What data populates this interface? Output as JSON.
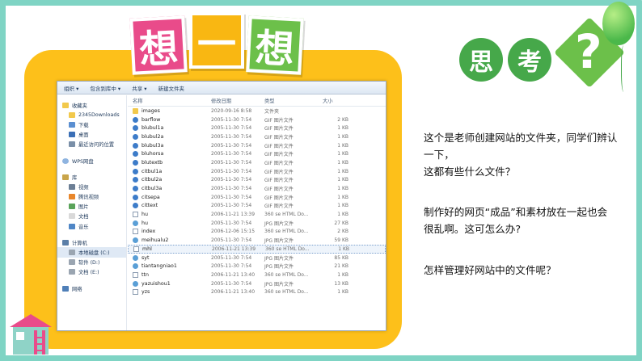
{
  "title_chars": [
    "想",
    "一",
    "想"
  ],
  "think": {
    "char1": "思",
    "char2": "考",
    "qmark": "?"
  },
  "toolbar": {
    "items": [
      "组织 ▾",
      "包含到库中 ▾",
      "共享 ▾",
      "新建文件夹"
    ]
  },
  "nav": {
    "favorites": "收藏夹",
    "fav_items": [
      "2345Downloads",
      "下载",
      "桌面",
      "最近访问的位置"
    ],
    "wps": "WPS网盘",
    "library": "库",
    "lib_items": [
      "视频",
      "腾讯视频",
      "图片",
      "文档",
      "音乐"
    ],
    "computer": "计算机",
    "comp_items": [
      "本地磁盘 (C:)",
      "软件 (D:)",
      "文档 (E:)"
    ],
    "network": "网络"
  },
  "columns": {
    "name": "名称",
    "date": "修改日期",
    "type": "类型",
    "size": "大小"
  },
  "files": [
    {
      "name": "images",
      "date": "2020-09-16 8:58",
      "type": "文件夹",
      "size": "",
      "icon": "folder"
    },
    {
      "name": "barflow",
      "date": "2005-11-30 7:54",
      "type": "GIF 图片文件",
      "size": "2 KB",
      "icon": "gif"
    },
    {
      "name": "blubul1a",
      "date": "2005-11-30 7:54",
      "type": "GIF 图片文件",
      "size": "1 KB",
      "icon": "gif"
    },
    {
      "name": "blubul2a",
      "date": "2005-11-30 7:54",
      "type": "GIF 图片文件",
      "size": "1 KB",
      "icon": "gif"
    },
    {
      "name": "blubul3a",
      "date": "2005-11-30 7:54",
      "type": "GIF 图片文件",
      "size": "1 KB",
      "icon": "gif"
    },
    {
      "name": "bluhorsa",
      "date": "2005-11-30 7:54",
      "type": "GIF 图片文件",
      "size": "1 KB",
      "icon": "gif"
    },
    {
      "name": "blutextb",
      "date": "2005-11-30 7:54",
      "type": "GIF 图片文件",
      "size": "1 KB",
      "icon": "gif"
    },
    {
      "name": "citbul1a",
      "date": "2005-11-30 7:54",
      "type": "GIF 图片文件",
      "size": "1 KB",
      "icon": "gif"
    },
    {
      "name": "citbul2a",
      "date": "2005-11-30 7:54",
      "type": "GIF 图片文件",
      "size": "1 KB",
      "icon": "gif"
    },
    {
      "name": "citbul3a",
      "date": "2005-11-30 7:54",
      "type": "GIF 图片文件",
      "size": "1 KB",
      "icon": "gif"
    },
    {
      "name": "citsepa",
      "date": "2005-11-30 7:54",
      "type": "GIF 图片文件",
      "size": "1 KB",
      "icon": "gif"
    },
    {
      "name": "cittext",
      "date": "2005-11-30 7:54",
      "type": "GIF 图片文件",
      "size": "1 KB",
      "icon": "gif"
    },
    {
      "name": "hu",
      "date": "2006-11-21 13:39",
      "type": "360 se HTML Do...",
      "size": "1 KB",
      "icon": "html"
    },
    {
      "name": "hu",
      "date": "2005-11-30 7:54",
      "type": "JPG 图片文件",
      "size": "27 KB",
      "icon": "jpg"
    },
    {
      "name": "index",
      "date": "2006-12-06 15:15",
      "type": "360 se HTML Do...",
      "size": "2 KB",
      "icon": "html"
    },
    {
      "name": "meihualu2",
      "date": "2005-11-30 7:54",
      "type": "JPG 图片文件",
      "size": "59 KB",
      "icon": "jpg"
    },
    {
      "name": "mhl",
      "date": "2006-11-21 13:39",
      "type": "360 se HTML Do...",
      "size": "1 KB",
      "icon": "html",
      "selected": true
    },
    {
      "name": "syt",
      "date": "2005-11-30 7:54",
      "type": "JPG 图片文件",
      "size": "85 KB",
      "icon": "jpg"
    },
    {
      "name": "tiantangniao1",
      "date": "2005-11-30 7:54",
      "type": "JPG 图片文件",
      "size": "21 KB",
      "icon": "jpg"
    },
    {
      "name": "ttn",
      "date": "2006-11-21 13:40",
      "type": "360 se HTML Do...",
      "size": "1 KB",
      "icon": "html"
    },
    {
      "name": "yazuishou1",
      "date": "2005-11-30 7:54",
      "type": "JPG 图片文件",
      "size": "13 KB",
      "icon": "jpg"
    },
    {
      "name": "yzs",
      "date": "2006-11-21 13:40",
      "type": "360 se HTML Do...",
      "size": "1 KB",
      "icon": "html"
    }
  ],
  "text": {
    "line1": "这个是老师创建网站的文件夹，同学们辨认",
    "line2": "一下，",
    "line3": "这都有些什么文件？",
    "line4": "制作好的网页“成品”和素材放在一起也会",
    "line5": "很乱啊。这可怎么办?",
    "line6": "怎样管理好网站中的文件呢？"
  },
  "colors": {
    "frame": "#7fd4c4",
    "panel": "#fdc01a",
    "green": "#46a84a",
    "pink": "#e94b8a"
  }
}
